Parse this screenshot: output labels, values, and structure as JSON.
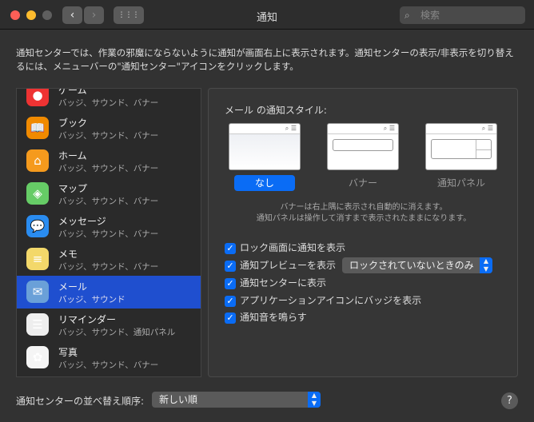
{
  "window": {
    "title": "通知",
    "search_placeholder": "検索",
    "back": "‹",
    "forward": "›",
    "grid": "⋮⋮⋮"
  },
  "description": "通知センターでは、作業の邪魔にならないように通知が画面右上に表示されます。通知センターの表示/非表示を切り替えるには、メニューバーの\"通知センター\"アイコンをクリックします。",
  "apps": [
    {
      "name": "ゲーム",
      "sub": "バッジ、サウンド、バナー",
      "icon": "game-center-icon",
      "glyph": "●",
      "color": "#e33"
    },
    {
      "name": "ブック",
      "sub": "バッジ、サウンド、バナー",
      "icon": "books-icon",
      "glyph": "📖",
      "color": "#f08a00"
    },
    {
      "name": "ホーム",
      "sub": "バッジ、サウンド、バナー",
      "icon": "home-icon",
      "glyph": "⌂",
      "color": "#f59a1d"
    },
    {
      "name": "マップ",
      "sub": "バッジ、サウンド、バナー",
      "icon": "maps-icon",
      "glyph": "◈",
      "color": "#6c6"
    },
    {
      "name": "メッセージ",
      "sub": "バッジ、サウンド、バナー",
      "icon": "messages-icon",
      "glyph": "💬",
      "color": "#2a8cf0"
    },
    {
      "name": "メモ",
      "sub": "バッジ、サウンド、バナー",
      "icon": "notes-icon",
      "glyph": "≡",
      "color": "#f3d86a"
    },
    {
      "name": "メール",
      "sub": "バッジ、サウンド",
      "icon": "mail-icon",
      "glyph": "✉",
      "color": "#6aa0d8"
    },
    {
      "name": "リマインダー",
      "sub": "バッジ、サウンド、通知パネル",
      "icon": "reminders-icon",
      "glyph": "☰",
      "color": "#eee"
    },
    {
      "name": "写真",
      "sub": "バッジ、サウンド、バナー",
      "icon": "photos-icon",
      "glyph": "✿",
      "color": "#f5f5f5"
    }
  ],
  "panel": {
    "title": "メール の通知スタイル:",
    "styles": [
      {
        "label": "なし",
        "selected": true
      },
      {
        "label": "バナー",
        "selected": false
      },
      {
        "label": "通知パネル",
        "selected": false
      }
    ],
    "thumb_icons": "⌕ ☰",
    "hint1": "バナーは右上隅に表示され自動的に消えます。",
    "hint2": "通知パネルは操作して消すまで表示されたままになります。",
    "options": [
      {
        "label": "ロック画面に通知を表示",
        "checked": true
      },
      {
        "label": "通知プレビューを表示",
        "checked": true
      },
      {
        "label": "通知センターに表示",
        "checked": true
      },
      {
        "label": "アプリケーションアイコンにバッジを表示",
        "checked": true
      },
      {
        "label": "通知音を鳴らす",
        "checked": true
      }
    ],
    "preview_select": "ロックされていないときのみ",
    "check": "✓"
  },
  "bottom": {
    "sort_label": "通知センターの並べ替え順序:",
    "sort_value": "新しい順",
    "help": "?"
  },
  "colors": {
    "accent": "#0a6cf5",
    "selection": "#1f4fcf"
  }
}
